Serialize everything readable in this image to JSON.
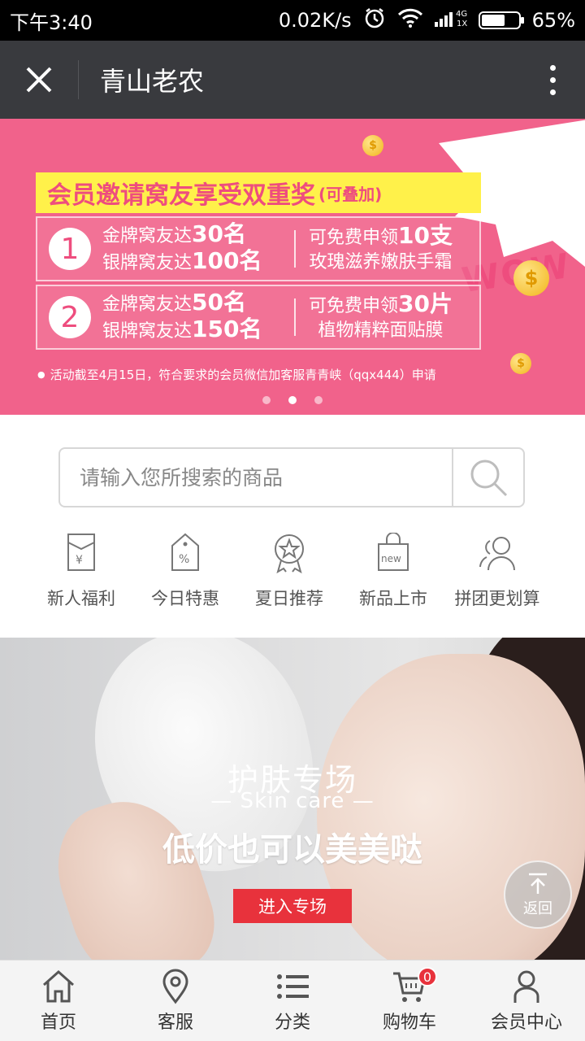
{
  "status_bar": {
    "time": "下午3:40",
    "network_speed": "0.02K/s",
    "network_type": "4G",
    "sim": "1X",
    "battery": "65%",
    "battery_level": 0.65
  },
  "header": {
    "title": "青山老农"
  },
  "banner": {
    "badge": "WOW",
    "title": "会员邀请窝友享受双重奖",
    "title_suffix": "(可叠加)",
    "rules": [
      {
        "number": "1",
        "gold": "金牌窝友达",
        "gold_count": "30名",
        "silver": "银牌窝友达",
        "silver_count": "100名",
        "reward_prefix": "可免费申领",
        "reward_count": "10支",
        "reward_item": "玫瑰滋养嫩肤手霜"
      },
      {
        "number": "2",
        "gold": "金牌窝友达",
        "gold_count": "50名",
        "silver": "银牌窝友达",
        "silver_count": "150名",
        "reward_prefix": "可免费申领",
        "reward_count": "30片",
        "reward_item": "植物精粹面贴膜"
      }
    ],
    "note": "活动截至4月15日，符合要求的会员微信加客服青青峡（qqx444）申请",
    "slides": 3,
    "active_slide": 2
  },
  "search": {
    "placeholder": "请输入您所搜索的商品"
  },
  "quick_nav": [
    {
      "label": "新人福利",
      "icon": "red-envelope-icon"
    },
    {
      "label": "今日特惠",
      "icon": "discount-tag-icon"
    },
    {
      "label": "夏日推荐",
      "icon": "star-badge-icon"
    },
    {
      "label": "新品上市",
      "icon": "new-bag-icon"
    },
    {
      "label": "拼团更划算",
      "icon": "group-users-icon"
    }
  ],
  "skin_care": {
    "title": "护肤专场",
    "subtitle": "— Skin care —",
    "slogan": "低价也可以美美哒",
    "button": "进入专场"
  },
  "back_to_top": {
    "label": "返回"
  },
  "tab_bar": [
    {
      "label": "首页",
      "icon": "home-icon"
    },
    {
      "label": "客服",
      "icon": "location-pin-icon"
    },
    {
      "label": "分类",
      "icon": "list-icon"
    },
    {
      "label": "购物车",
      "icon": "cart-icon",
      "badge": "0"
    },
    {
      "label": "会员中心",
      "icon": "user-icon"
    }
  ],
  "colors": {
    "banner_bg": "#f1628b",
    "header_bg": "#393a3e",
    "accent_red": "#e8323c",
    "title_yellow": "#fff14a"
  }
}
